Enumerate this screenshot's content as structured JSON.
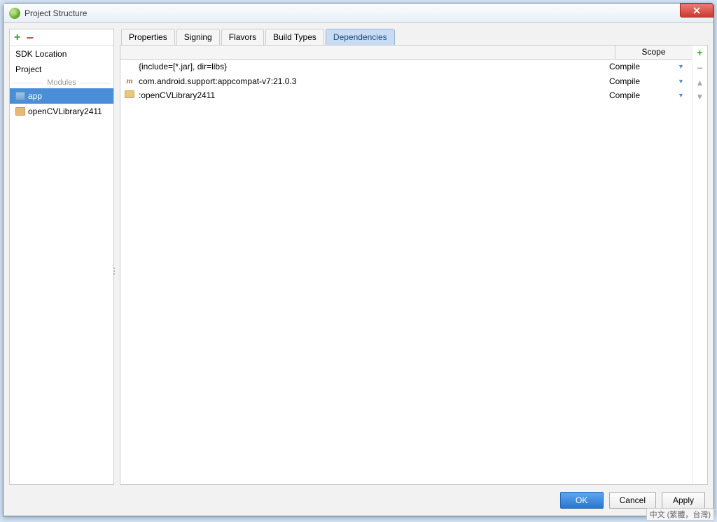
{
  "window": {
    "title": "Project Structure"
  },
  "sidebar": {
    "items": [
      {
        "label": "SDK Location"
      },
      {
        "label": "Project"
      }
    ],
    "modules_label": "Modules",
    "modules": [
      {
        "label": "app",
        "selected": true
      },
      {
        "label": "openCVLibrary2411",
        "selected": false
      }
    ]
  },
  "tabs": [
    {
      "label": "Properties"
    },
    {
      "label": "Signing"
    },
    {
      "label": "Flavors"
    },
    {
      "label": "Build Types"
    },
    {
      "label": "Dependencies",
      "active": true
    }
  ],
  "dep_header": {
    "scope": "Scope"
  },
  "dependencies": [
    {
      "icon": "",
      "text": "{include=[*.jar], dir=libs}",
      "scope": "Compile"
    },
    {
      "icon": "m",
      "text": "com.android.support:appcompat-v7:21.0.3",
      "scope": "Compile"
    },
    {
      "icon": "folder",
      "text": ":openCVLibrary2411",
      "scope": "Compile"
    }
  ],
  "buttons": {
    "ok": "OK",
    "cancel": "Cancel",
    "apply": "Apply"
  },
  "ime": "中文 (繁體，台灣)"
}
